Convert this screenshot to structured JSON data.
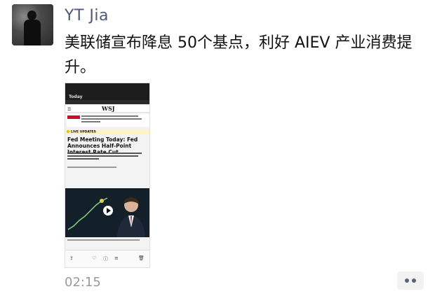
{
  "post": {
    "author": "YT Jia",
    "text": "美联储宣布降息 50个基点，利好 AIEV 产业消费提升。",
    "time": "02:15"
  },
  "attachment": {
    "today_label": "Today",
    "masthead": "WSJ",
    "live_label": "LIVE UPDATES",
    "headline": "Fed Meeting Today: Fed Announces Half-Point Interest Rate Cut"
  },
  "icons": {
    "more": "ellipsis-icon",
    "share": "share-icon",
    "like": "heart-icon",
    "info": "info-icon",
    "font": "text-size-icon",
    "trash": "trash-icon",
    "play": "play-icon"
  },
  "colors": {
    "author": "#4f5a7a",
    "time": "#9a9a9a"
  }
}
